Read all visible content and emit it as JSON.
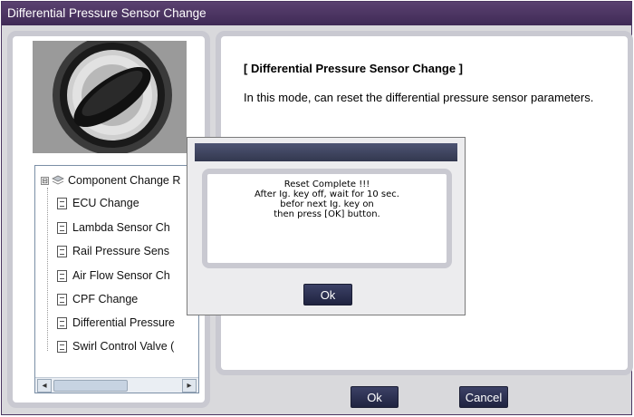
{
  "window": {
    "title": "Differential Pressure Sensor Change"
  },
  "photo": {
    "description_icon": "ignition-key-switch-image"
  },
  "tree": {
    "root_label": "Component Change R",
    "expander": "⊟",
    "items": [
      {
        "label": "ECU Change"
      },
      {
        "label": "Lambda Sensor Ch"
      },
      {
        "label": "Rail Pressure Sens"
      },
      {
        "label": "Air Flow Sensor Ch"
      },
      {
        "label": "CPF Change"
      },
      {
        "label": "Differential Pressure"
      },
      {
        "label": "Swirl Control Valve ("
      }
    ],
    "scroll_left": "◂",
    "scroll_right": "▸"
  },
  "main": {
    "heading": "[ Differential Pressure Sensor Change ]",
    "description": "In this mode, can reset the differential pressure sensor parameters."
  },
  "dialog": {
    "lines": [
      "Reset Complete !!!",
      "After Ig. key off, wait for 10 sec.",
      "befor next Ig. key on",
      "then press [OK] button."
    ],
    "ok_label": "Ok"
  },
  "footer": {
    "ok_label": "Ok",
    "cancel_label": "Cancel"
  },
  "colors": {
    "titlebar": "#4b3563",
    "panel_border": "#c9c9d1",
    "button": "#2a2e4d",
    "dialog_bar": "#434862"
  }
}
